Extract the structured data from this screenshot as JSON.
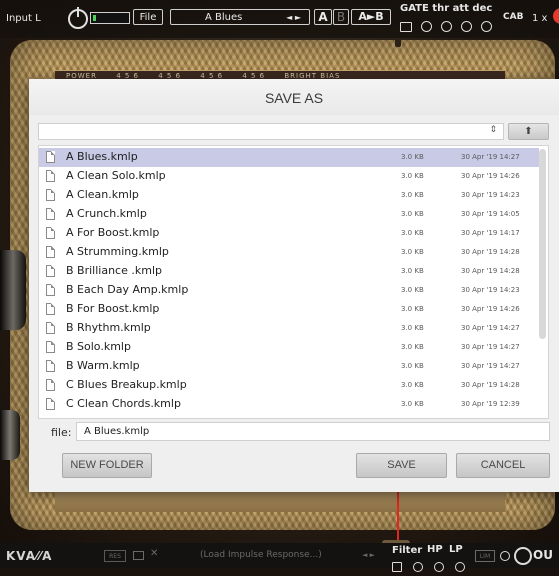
{
  "toolbar": {
    "input_label": "Input L",
    "file_label": "File",
    "preset_name": "A Blues",
    "preset_arrows": "◄ ►",
    "a_label": "A",
    "b_label": "B",
    "ab_label": "A►B",
    "gate_label": "GATE thr att dec",
    "cab_label": "CAB",
    "zoom_label": "1 x"
  },
  "amp_panel": {
    "labels": [
      "POWER",
      "4 5 6",
      "4 5 6",
      "4 5 6",
      "4 5 6",
      "BRIGHT BIAS"
    ]
  },
  "dialog": {
    "title": "SAVE AS",
    "path_updown_icon": "⇕",
    "up_icon": "⬆",
    "files": [
      {
        "name": "A Blues.kmlp",
        "size": "3.0 KB",
        "date": "30 Apr '19 14:27"
      },
      {
        "name": "A Clean Solo.kmlp",
        "size": "3.0 KB",
        "date": "30 Apr '19 14:26"
      },
      {
        "name": "A Clean.kmlp",
        "size": "3.0 KB",
        "date": "30 Apr '19 14:23"
      },
      {
        "name": "A Crunch.kmlp",
        "size": "3.0 KB",
        "date": "30 Apr '19 14:05"
      },
      {
        "name": "A For Boost.kmlp",
        "size": "3.0 KB",
        "date": "30 Apr '19 14:17"
      },
      {
        "name": "A Strumming.kmlp",
        "size": "3.0 KB",
        "date": "30 Apr '19 14:28"
      },
      {
        "name": "B Brilliance .kmlp",
        "size": "3.0 KB",
        "date": "30 Apr '19 14:28"
      },
      {
        "name": "B Each Day Amp.kmlp",
        "size": "3.0 KB",
        "date": "30 Apr '19 14:23"
      },
      {
        "name": "B For Boost.kmlp",
        "size": "3.0 KB",
        "date": "30 Apr '19 14:26"
      },
      {
        "name": "B Rhythm.kmlp",
        "size": "3.0 KB",
        "date": "30 Apr '19 14:27"
      },
      {
        "name": "B Solo.kmlp",
        "size": "3.0 KB",
        "date": "30 Apr '19 14:27"
      },
      {
        "name": "B Warm.kmlp",
        "size": "3.0 KB",
        "date": "30 Apr '19 14:27"
      },
      {
        "name": "C Blues Breakup.kmlp",
        "size": "3.0 KB",
        "date": "30 Apr '19 14:28"
      },
      {
        "name": "C Clean Chords.kmlp",
        "size": "3.0 KB",
        "date": "30 Apr '19 12:39"
      }
    ],
    "selected_index": 0,
    "file_field_label": "file:",
    "file_field_value": "A Blues.kmlp",
    "new_folder_label": "NEW FOLDER",
    "save_label": "SAVE",
    "cancel_label": "CANCEL"
  },
  "bottom": {
    "logo": "KVA⁄⁄A",
    "res_label": "RES",
    "close_glyph": "✕",
    "load_ir_label": "(Load Impulse Response...)",
    "ir_arrows": "◄ ►",
    "filter_label": "Filter",
    "hp_label": "HP",
    "lp_label": "LP",
    "lim_label": "LIM",
    "out_label": "OU"
  },
  "colors": {
    "selected_row": "#c9cbe6",
    "power_led": "#e8382a",
    "meter_green": "#4cd15a",
    "cable_red": "#e52620"
  }
}
